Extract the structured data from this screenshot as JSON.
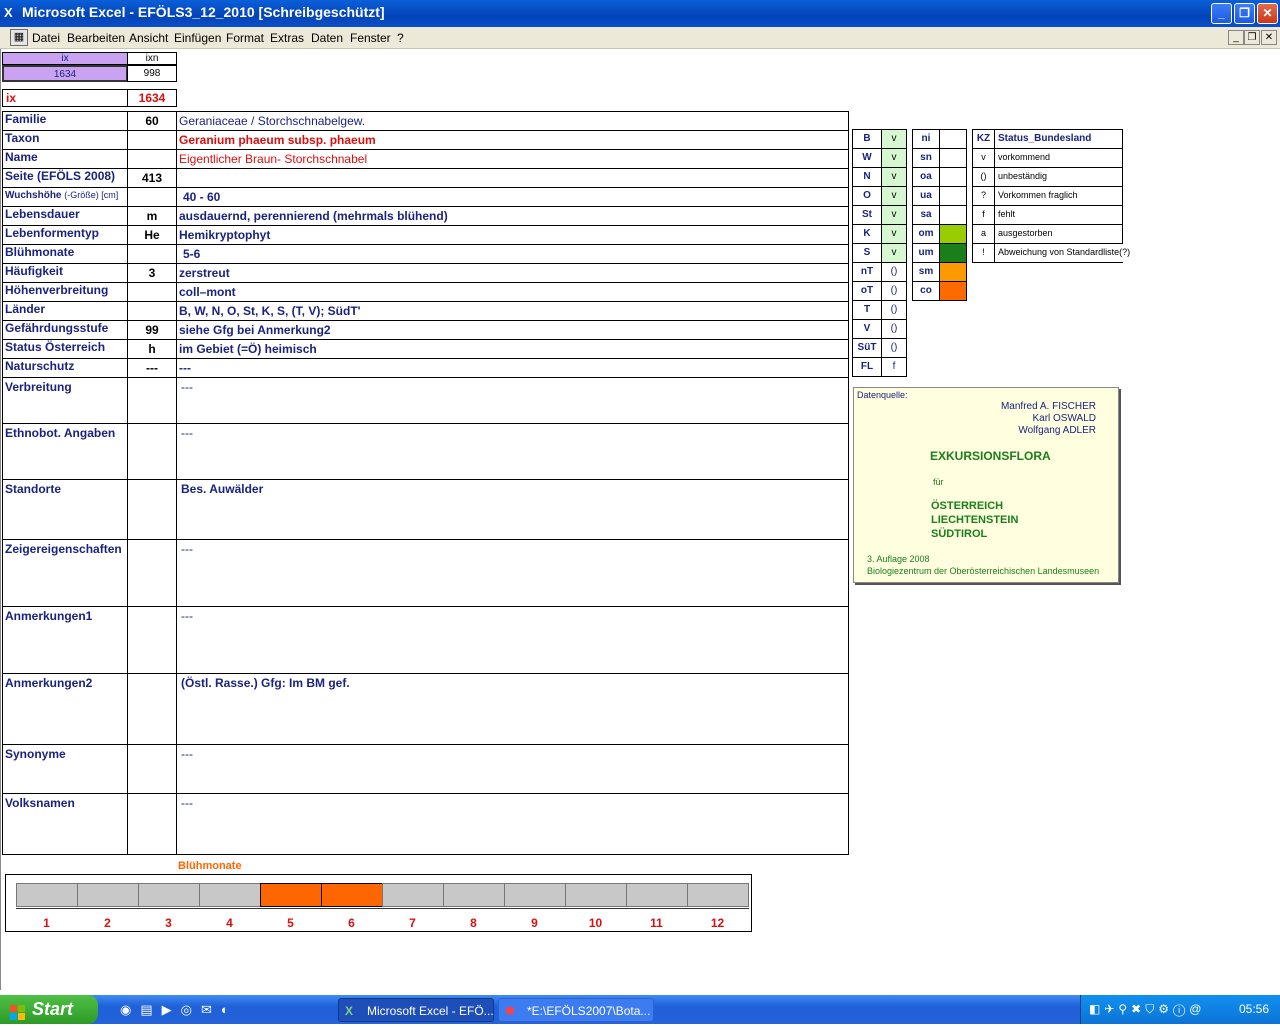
{
  "window": {
    "title": "Microsoft Excel - EFÖLS3_12_2010  [Schreibgeschützt]",
    "app_icon": "excel-icon"
  },
  "menu": [
    "Datei",
    "Bearbeiten",
    "Ansicht",
    "Einfügen",
    "Format",
    "Extras",
    "Daten",
    "Fenster",
    "?"
  ],
  "top_cells": {
    "ix_header": "ix",
    "ixn_header": "ixn",
    "ix_value": "1634",
    "ixn_value": "998"
  },
  "ix_row": {
    "label": "ix",
    "value": "1634"
  },
  "rows": [
    {
      "label": "Familie",
      "code": "60",
      "text": "Geraniaceae  /  Storchschnabelgew."
    },
    {
      "label": "Taxon",
      "code": "",
      "text": "Geranium phaeum subsp. phaeum"
    },
    {
      "label": "Name",
      "code": "",
      "text": "Eigentlicher Braun- Storchschnabel"
    },
    {
      "label": "Seite (EFÖLS 2008)",
      "code": "413",
      "text": ""
    },
    {
      "label": "Wuchshöhe",
      "label_suffix": "(-Größe) [cm]",
      "code": "",
      "text": "40 - 60"
    },
    {
      "label": "Lebensdauer",
      "code": "m",
      "text": "ausdauernd, perennierend (mehrmals blühend)"
    },
    {
      "label": "Lebenformentyp",
      "code": "He",
      "text": "Hemikryptophyt"
    },
    {
      "label": "Blühmonate",
      "code": "",
      "text": "5-6"
    },
    {
      "label": "Häufigkeit",
      "code": "3",
      "text": "zerstreut"
    },
    {
      "label": "Höhenverbreitung",
      "code": "",
      "text": "coll–mont"
    },
    {
      "label": "Länder",
      "code": "",
      "text": "B, W, N, O, St, K, S, (T, V); SüdT'"
    },
    {
      "label": "Gefährdungsstufe",
      "code": "99",
      "text": "siehe Gfg bei Anmerkung2"
    },
    {
      "label": "Status Österreich",
      "code": "h",
      "text": "im Gebiet (=Ö) heimisch"
    },
    {
      "label": "Naturschutz",
      "code": "---",
      "text": "---"
    }
  ],
  "big_rows": [
    {
      "label": "Verbreitung",
      "text": "---"
    },
    {
      "label": "Ethnobot. Angaben",
      "text": "---"
    },
    {
      "label": "Standorte",
      "text": "Bes. Auwälder"
    },
    {
      "label": "Zeigereigenschaften",
      "text": "---"
    },
    {
      "label": "Anmerkungen1",
      "text": "---"
    },
    {
      "label": "Anmerkungen2",
      "text": "(Östl. Rasse.)  Gfg: Im BM gef."
    },
    {
      "label": "Synonyme",
      "text": "---"
    },
    {
      "label": "Volksnamen",
      "text": "---"
    }
  ],
  "states": [
    {
      "abbr": "B",
      "status": "v"
    },
    {
      "abbr": "W",
      "status": "v"
    },
    {
      "abbr": "N",
      "status": "v"
    },
    {
      "abbr": "O",
      "status": "v"
    },
    {
      "abbr": "St",
      "status": "v"
    },
    {
      "abbr": "K",
      "status": "v"
    },
    {
      "abbr": "S",
      "status": "v"
    },
    {
      "abbr": "nT",
      "status": "()"
    },
    {
      "abbr": "oT",
      "status": "()"
    },
    {
      "abbr": "T",
      "status": "()"
    },
    {
      "abbr": "V",
      "status": "()"
    },
    {
      "abbr": "SüT",
      "status": "()"
    },
    {
      "abbr": "FL",
      "status": "f"
    }
  ],
  "altitudes": [
    {
      "abbr": "ni",
      "color": ""
    },
    {
      "abbr": "sn",
      "color": ""
    },
    {
      "abbr": "oa",
      "color": ""
    },
    {
      "abbr": "ua",
      "color": ""
    },
    {
      "abbr": "sa",
      "color": ""
    },
    {
      "abbr": "om",
      "color": "#9acd00"
    },
    {
      "abbr": "um",
      "color": "#1a7f1a"
    },
    {
      "abbr": "sm",
      "color": "#ff9900"
    },
    {
      "abbr": "co",
      "color": "#ff6a00"
    }
  ],
  "legend": {
    "header_kz": "KZ",
    "header_status": "Status_Bundesland",
    "items": [
      {
        "kz": "v",
        "text": "vorkommend"
      },
      {
        "kz": "()",
        "text": "unbeständig"
      },
      {
        "kz": "?",
        "text": "Vorkommen fraglich"
      },
      {
        "kz": "f",
        "text": "fehlt"
      },
      {
        "kz": "a",
        "text": "ausgestorben"
      },
      {
        "kz": "!",
        "text": "Abweichung von Standardliste(?)"
      }
    ]
  },
  "source": {
    "label": "Datenquelle:",
    "authors": [
      "Manfred A. FISCHER",
      "Karl OSWALD",
      "Wolfgang ADLER"
    ],
    "title": "EXKURSIONSFLORA",
    "for": "für",
    "regions": [
      "ÖSTERREICH",
      "LIECHTENSTEIN",
      "SÜDTIROL"
    ],
    "edition": "3. Auflage 2008",
    "publisher": "Biologiezentrum der Oberösterreichischen Landesmuseen"
  },
  "bloom_chart": {
    "title": "Blühmonate",
    "months": [
      "1",
      "2",
      "3",
      "4",
      "5",
      "6",
      "7",
      "8",
      "9",
      "10",
      "11",
      "12"
    ],
    "active": [
      5,
      6
    ],
    "active_color": "#ff6600",
    "inactive_color": "#c8c8c8"
  },
  "taskbar": {
    "start": "Start",
    "tasks": [
      "Microsoft Excel - EFÖ...",
      "*E:\\EFÖLS2007\\Bota..."
    ],
    "clock": "05:56"
  }
}
